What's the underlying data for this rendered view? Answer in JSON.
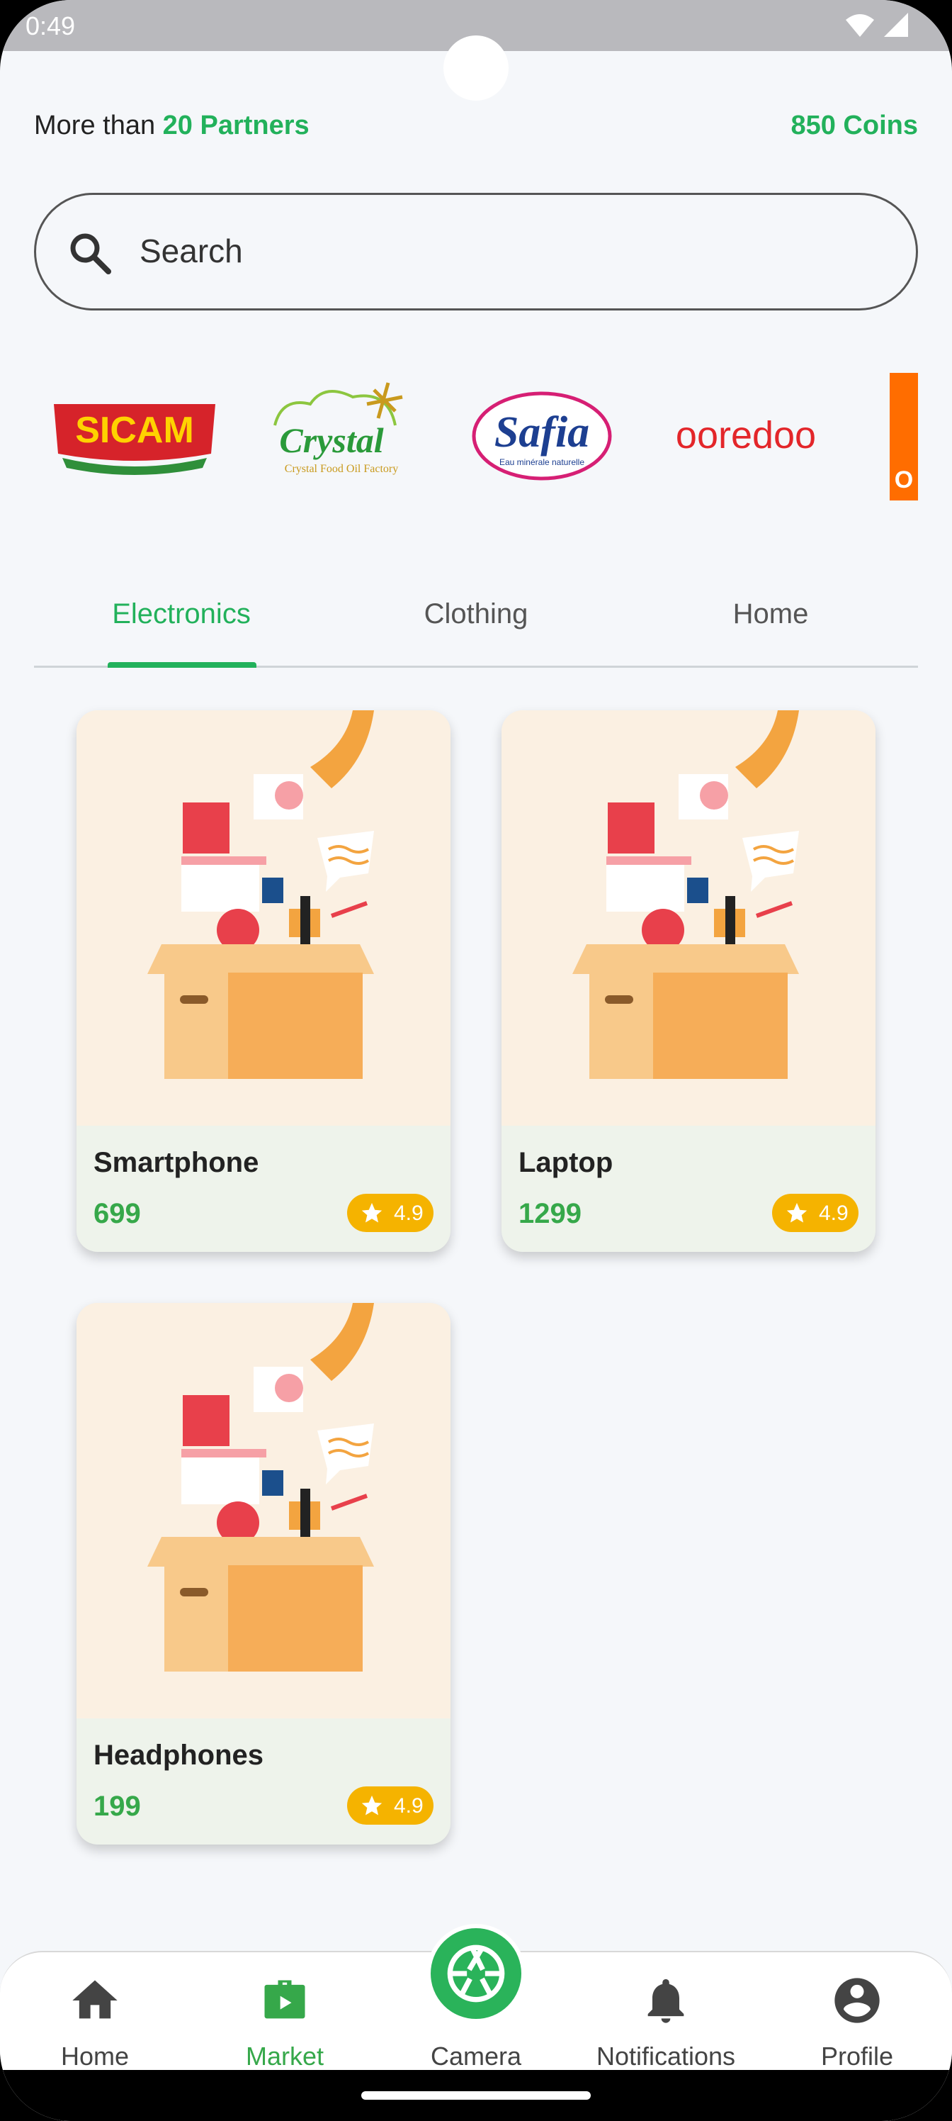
{
  "status_bar": {
    "time": "0:49"
  },
  "header": {
    "partners_lead": "More than ",
    "partners_count": "20 Partners",
    "coins": "850 Coins"
  },
  "search": {
    "placeholder": "Search"
  },
  "partners": [
    {
      "name": "SICAM",
      "text": "SICAM"
    },
    {
      "name": "Crystal",
      "text": "Crystal",
      "subtext": "Crystal Food Oil Factory"
    },
    {
      "name": "Safia",
      "text": "Safia",
      "subtext": "Eau minérale naturelle"
    },
    {
      "name": "ooredoo",
      "text": "ooredoo"
    },
    {
      "name": "Orange",
      "text": "O"
    }
  ],
  "tabs": [
    {
      "label": "Electronics",
      "active": true
    },
    {
      "label": "Clothing",
      "active": false
    },
    {
      "label": "Home",
      "active": false
    }
  ],
  "products": [
    {
      "name": "Smartphone",
      "price": "699",
      "rating": "4.9"
    },
    {
      "name": "Laptop",
      "price": "1299",
      "rating": "4.9"
    },
    {
      "name": "Headphones",
      "price": "199",
      "rating": "4.9"
    }
  ],
  "bottom_nav": [
    {
      "label": "Home",
      "icon": "home-icon",
      "active": false
    },
    {
      "label": "Market",
      "icon": "market-icon",
      "active": true
    },
    {
      "label": "Camera",
      "icon": "camera-shutter-icon",
      "active": false
    },
    {
      "label": "Notifications",
      "icon": "bell-icon",
      "active": false
    },
    {
      "label": "Profile",
      "icon": "profile-icon",
      "active": false
    }
  ],
  "colors": {
    "accent": "#22b15b",
    "rating": "#f5b300",
    "card_bg": "#eef3eb"
  }
}
